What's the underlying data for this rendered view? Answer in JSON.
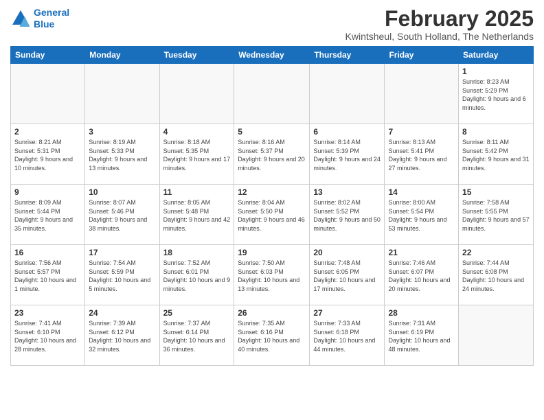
{
  "logo": {
    "line1": "General",
    "line2": "Blue"
  },
  "title": "February 2025",
  "subtitle": "Kwintsheul, South Holland, The Netherlands",
  "days_of_week": [
    "Sunday",
    "Monday",
    "Tuesday",
    "Wednesday",
    "Thursday",
    "Friday",
    "Saturday"
  ],
  "weeks": [
    [
      {
        "day": "",
        "info": ""
      },
      {
        "day": "",
        "info": ""
      },
      {
        "day": "",
        "info": ""
      },
      {
        "day": "",
        "info": ""
      },
      {
        "day": "",
        "info": ""
      },
      {
        "day": "",
        "info": ""
      },
      {
        "day": "1",
        "info": "Sunrise: 8:23 AM\nSunset: 5:29 PM\nDaylight: 9 hours and 6 minutes."
      }
    ],
    [
      {
        "day": "2",
        "info": "Sunrise: 8:21 AM\nSunset: 5:31 PM\nDaylight: 9 hours and 10 minutes."
      },
      {
        "day": "3",
        "info": "Sunrise: 8:19 AM\nSunset: 5:33 PM\nDaylight: 9 hours and 13 minutes."
      },
      {
        "day": "4",
        "info": "Sunrise: 8:18 AM\nSunset: 5:35 PM\nDaylight: 9 hours and 17 minutes."
      },
      {
        "day": "5",
        "info": "Sunrise: 8:16 AM\nSunset: 5:37 PM\nDaylight: 9 hours and 20 minutes."
      },
      {
        "day": "6",
        "info": "Sunrise: 8:14 AM\nSunset: 5:39 PM\nDaylight: 9 hours and 24 minutes."
      },
      {
        "day": "7",
        "info": "Sunrise: 8:13 AM\nSunset: 5:41 PM\nDaylight: 9 hours and 27 minutes."
      },
      {
        "day": "8",
        "info": "Sunrise: 8:11 AM\nSunset: 5:42 PM\nDaylight: 9 hours and 31 minutes."
      }
    ],
    [
      {
        "day": "9",
        "info": "Sunrise: 8:09 AM\nSunset: 5:44 PM\nDaylight: 9 hours and 35 minutes."
      },
      {
        "day": "10",
        "info": "Sunrise: 8:07 AM\nSunset: 5:46 PM\nDaylight: 9 hours and 38 minutes."
      },
      {
        "day": "11",
        "info": "Sunrise: 8:05 AM\nSunset: 5:48 PM\nDaylight: 9 hours and 42 minutes."
      },
      {
        "day": "12",
        "info": "Sunrise: 8:04 AM\nSunset: 5:50 PM\nDaylight: 9 hours and 46 minutes."
      },
      {
        "day": "13",
        "info": "Sunrise: 8:02 AM\nSunset: 5:52 PM\nDaylight: 9 hours and 50 minutes."
      },
      {
        "day": "14",
        "info": "Sunrise: 8:00 AM\nSunset: 5:54 PM\nDaylight: 9 hours and 53 minutes."
      },
      {
        "day": "15",
        "info": "Sunrise: 7:58 AM\nSunset: 5:55 PM\nDaylight: 9 hours and 57 minutes."
      }
    ],
    [
      {
        "day": "16",
        "info": "Sunrise: 7:56 AM\nSunset: 5:57 PM\nDaylight: 10 hours and 1 minute."
      },
      {
        "day": "17",
        "info": "Sunrise: 7:54 AM\nSunset: 5:59 PM\nDaylight: 10 hours and 5 minutes."
      },
      {
        "day": "18",
        "info": "Sunrise: 7:52 AM\nSunset: 6:01 PM\nDaylight: 10 hours and 9 minutes."
      },
      {
        "day": "19",
        "info": "Sunrise: 7:50 AM\nSunset: 6:03 PM\nDaylight: 10 hours and 13 minutes."
      },
      {
        "day": "20",
        "info": "Sunrise: 7:48 AM\nSunset: 6:05 PM\nDaylight: 10 hours and 17 minutes."
      },
      {
        "day": "21",
        "info": "Sunrise: 7:46 AM\nSunset: 6:07 PM\nDaylight: 10 hours and 20 minutes."
      },
      {
        "day": "22",
        "info": "Sunrise: 7:44 AM\nSunset: 6:08 PM\nDaylight: 10 hours and 24 minutes."
      }
    ],
    [
      {
        "day": "23",
        "info": "Sunrise: 7:41 AM\nSunset: 6:10 PM\nDaylight: 10 hours and 28 minutes."
      },
      {
        "day": "24",
        "info": "Sunrise: 7:39 AM\nSunset: 6:12 PM\nDaylight: 10 hours and 32 minutes."
      },
      {
        "day": "25",
        "info": "Sunrise: 7:37 AM\nSunset: 6:14 PM\nDaylight: 10 hours and 36 minutes."
      },
      {
        "day": "26",
        "info": "Sunrise: 7:35 AM\nSunset: 6:16 PM\nDaylight: 10 hours and 40 minutes."
      },
      {
        "day": "27",
        "info": "Sunrise: 7:33 AM\nSunset: 6:18 PM\nDaylight: 10 hours and 44 minutes."
      },
      {
        "day": "28",
        "info": "Sunrise: 7:31 AM\nSunset: 6:19 PM\nDaylight: 10 hours and 48 minutes."
      },
      {
        "day": "",
        "info": ""
      }
    ]
  ]
}
